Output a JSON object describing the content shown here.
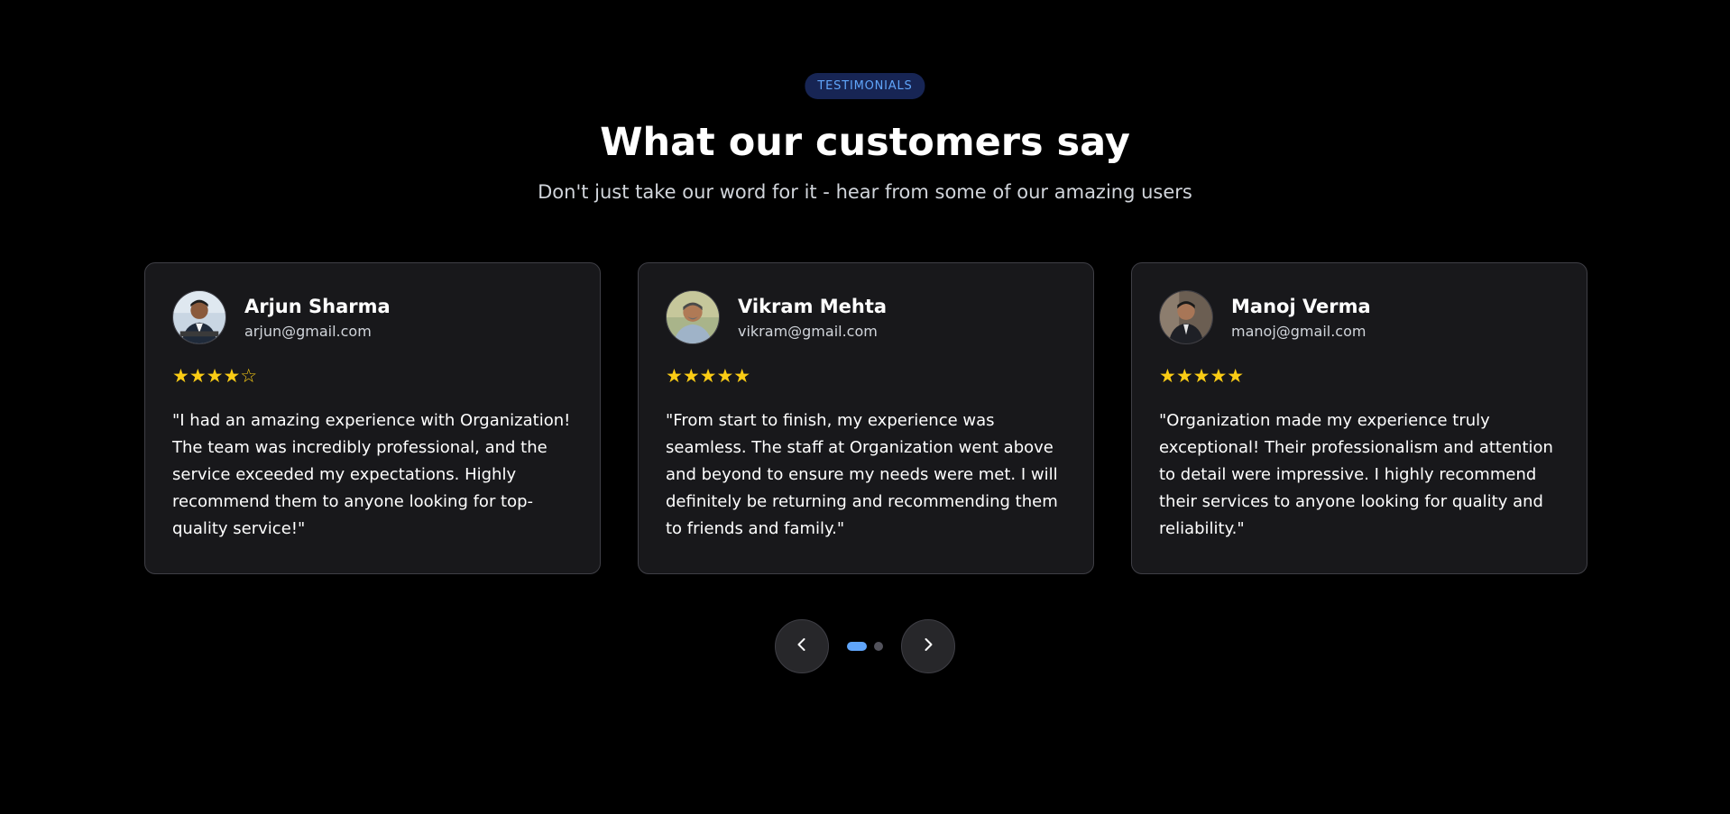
{
  "header": {
    "badge": "TESTIMONIALS",
    "title": "What our customers say",
    "subtitle": "Don't just take our word for it - hear from some of our amazing users"
  },
  "testimonials": [
    {
      "name": "Arjun Sharma",
      "email": "arjun@gmail.com",
      "rating": 4,
      "max_rating": 5,
      "stars_text": "★★★★☆",
      "quote": "\"I had an amazing experience with Organization! The team was incredibly professional, and the service exceeded my expectations. Highly recommend them to anyone looking for top-quality service!\""
    },
    {
      "name": "Vikram Mehta",
      "email": "vikram@gmail.com",
      "rating": 5,
      "max_rating": 5,
      "stars_text": "★★★★★",
      "quote": "\"From start to finish, my experience was seamless. The staff at Organization went above and beyond to ensure my needs were met. I will definitely be returning and recommending them to friends and family.\""
    },
    {
      "name": "Manoj Verma",
      "email": "manoj@gmail.com",
      "rating": 5,
      "max_rating": 5,
      "stars_text": "★★★★★",
      "quote": "\"Organization made my experience truly exceptional! Their professionalism and attention to detail were impressive. I highly recommend their services to anyone looking for quality and reliability.\""
    }
  ],
  "pagination": {
    "pages": 2,
    "active_page": 1,
    "prev_icon": "chevron-left-icon",
    "next_icon": "chevron-right-icon"
  },
  "colors": {
    "background": "#000000",
    "card_background": "#18181b",
    "accent": "#60a5fa",
    "star": "#facc15"
  }
}
